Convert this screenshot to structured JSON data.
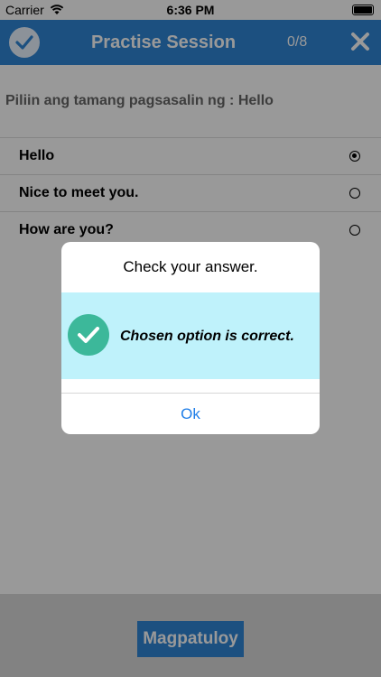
{
  "status_bar": {
    "carrier": "Carrier",
    "time": "6:36 PM"
  },
  "header": {
    "title": "Practise Session",
    "progress": "0/8",
    "accent_color": "#2f85d6"
  },
  "question": {
    "prompt": "Piliin ang tamang pagsasalin ng : Hello"
  },
  "options": [
    {
      "label": "Hello",
      "selected": true
    },
    {
      "label": "Nice to meet you.",
      "selected": false
    },
    {
      "label": "How are you?",
      "selected": false
    }
  ],
  "footer": {
    "continue_label": "Magpatuloy"
  },
  "dialog": {
    "title": "Check your answer.",
    "message": "Chosen option is correct.",
    "ok_label": "Ok",
    "message_bg": "#bff2fb",
    "icon": "check-circle-icon"
  }
}
